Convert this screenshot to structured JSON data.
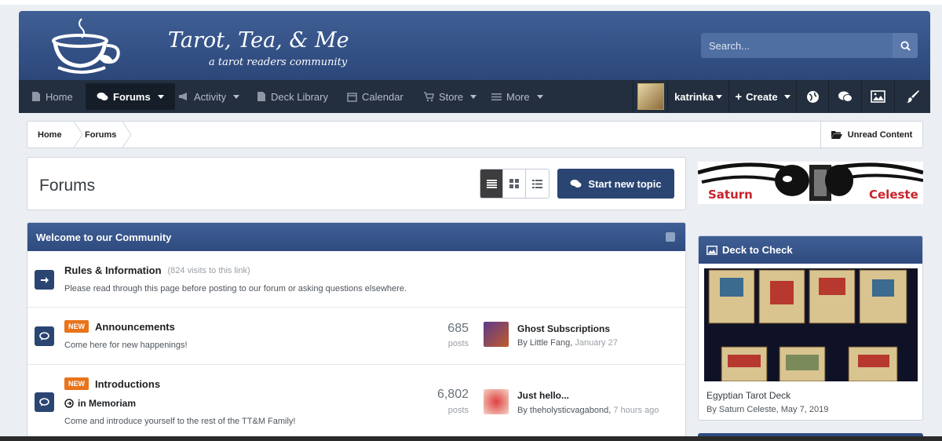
{
  "site": {
    "title": "Tarot, Tea, & Me",
    "subtitle": "a tarot readers community"
  },
  "search": {
    "placeholder": "Search..."
  },
  "nav": {
    "home": "Home",
    "forums": "Forums",
    "activity": "Activity",
    "deck_library": "Deck Library",
    "calendar": "Calendar",
    "store": "Store",
    "more": "More",
    "user": "katrinka",
    "create": "Create"
  },
  "breadcrumb": {
    "home": "Home",
    "forums": "Forums",
    "unread": "Unread Content"
  },
  "page": {
    "title": "Forums",
    "start_topic": "Start new topic"
  },
  "category": {
    "title": "Welcome to our Community",
    "forums": [
      {
        "title": "Rules & Information",
        "visits": "(824 visits to this link)",
        "desc": "Please read through this page before posting to our forum or asking questions elsewhere."
      },
      {
        "badge": "NEW",
        "title": "Announcements",
        "desc": "Come here for new happenings!",
        "posts": "685",
        "posts_label": "posts",
        "last_title": "Ghost Subscriptions",
        "last_by": "By Little Fang,",
        "last_date": "January 27"
      },
      {
        "badge": "NEW",
        "title": "Introductions",
        "subforum": "in Memoriam",
        "desc": "Come and introduce yourself to the rest of the TT&M Family!",
        "posts": "6,802",
        "posts_label": "posts",
        "last_title": "Just hello...",
        "last_by": "By theholysticvagabond,",
        "last_date": "7 hours ago"
      }
    ]
  },
  "sidebar": {
    "ad_left": "Saturn",
    "ad_right": "Celeste",
    "widget_title": "Deck to Check",
    "deck_title": "Egyptian Tarot Deck",
    "deck_by": "By Saturn Celeste, May 7, 2019"
  },
  "colors": {
    "brand": "#2b4573",
    "header": "#3f5f95",
    "nav": "#232f3f",
    "badge": "#e8741b"
  }
}
